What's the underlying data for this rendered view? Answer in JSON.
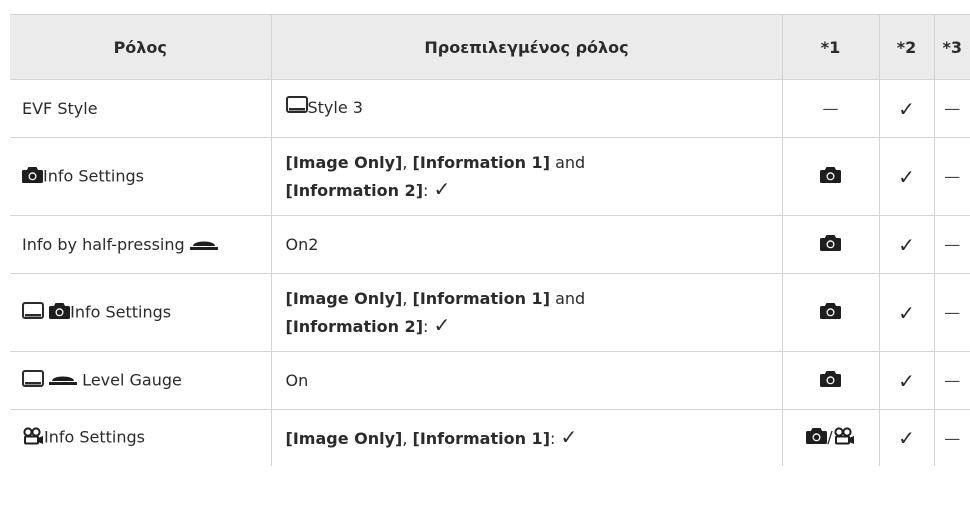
{
  "header": {
    "role": "Ρόλος",
    "default_role": "Προεπιλεγμένος ρόλος",
    "c1": "*1",
    "c2": "*2",
    "c3": "*3"
  },
  "rows": [
    {
      "role_text": "EVF Style",
      "default_text": "Style 3",
      "c1": "—",
      "c2": "✓",
      "c3": "—"
    },
    {
      "role_text": "Info Settings",
      "d1": "[Image Only]",
      "d2": ", ",
      "d3": "[Information 1]",
      "d4": " and",
      "d5": "[Information 2]",
      "d6": ": ",
      "d7": "✓",
      "c2": "✓",
      "c3": "—"
    },
    {
      "role_text": "Info by half-pressing",
      "default_text": "On2",
      "c2": "✓",
      "c3": "—"
    },
    {
      "role_text": "Info Settings",
      "d1": "[Image Only]",
      "d2": ", ",
      "d3": "[Information 1]",
      "d4": " and",
      "d5": "[Information 2]",
      "d6": ": ",
      "d7": "✓",
      "c2": "✓",
      "c3": "—"
    },
    {
      "role_text": " Level Gauge",
      "default_text": "On",
      "c2": "✓",
      "c3": "—"
    },
    {
      "role_text": "Info Settings",
      "d1": "[Image Only]",
      "d2": ", ",
      "d3": "[Information 1]",
      "d4": ": ",
      "d5": "✓",
      "c1_sep": "/",
      "c2": "✓",
      "c3": "—"
    }
  ],
  "icons": {
    "monitor": "monitor-icon",
    "camera": "camera-icon",
    "shutter": "shutter-button-icon",
    "movie": "movie-icon"
  }
}
